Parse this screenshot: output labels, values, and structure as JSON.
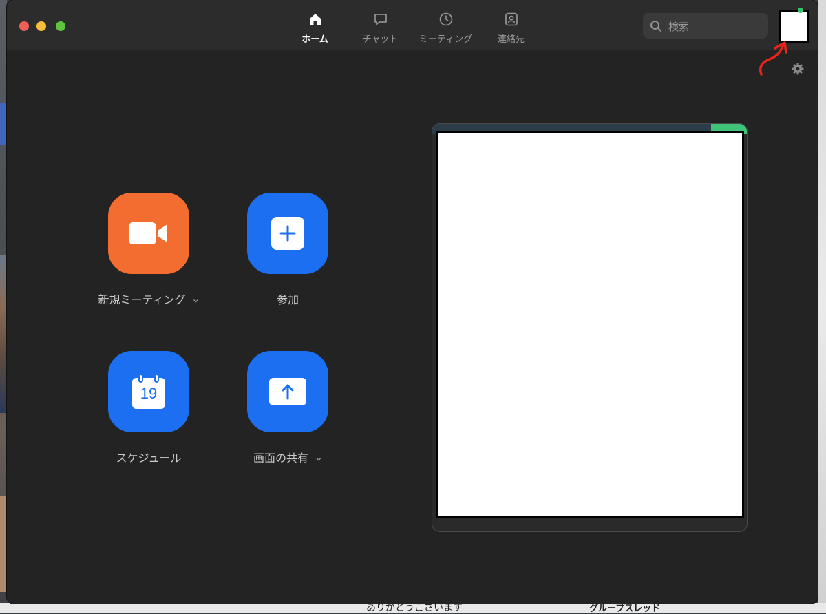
{
  "nav": {
    "tabs": [
      {
        "label": "ホーム",
        "icon": "home-icon",
        "active": true
      },
      {
        "label": "チャット",
        "icon": "chat-icon",
        "active": false
      },
      {
        "label": "ミーティング",
        "icon": "clock-icon",
        "active": false
      },
      {
        "label": "連絡先",
        "icon": "contacts-icon",
        "active": false
      }
    ]
  },
  "search": {
    "placeholder": "検索"
  },
  "actions": [
    {
      "label": "新規ミーティング",
      "icon": "video-camera-icon",
      "color": "#f26d2f",
      "has_dropdown": true
    },
    {
      "label": "参加",
      "icon": "plus-icon",
      "color": "#1d6ff2",
      "has_dropdown": false
    },
    {
      "label": "スケジュール",
      "icon": "calendar-icon",
      "calendar_day": "19",
      "color": "#1d6ff2",
      "has_dropdown": false
    },
    {
      "label": "画面の共有",
      "icon": "share-screen-icon",
      "color": "#1d6ff2",
      "has_dropdown": true
    }
  ],
  "background": {
    "bottom_text_1": "ありがとうございます",
    "bottom_text_2": "グループスレッド"
  },
  "colors": {
    "window_bg": "#232323",
    "titlebar_bg": "#2c2c2c",
    "orange": "#f26d2f",
    "blue": "#1d6ff2",
    "annotation_red": "#e8231a"
  }
}
